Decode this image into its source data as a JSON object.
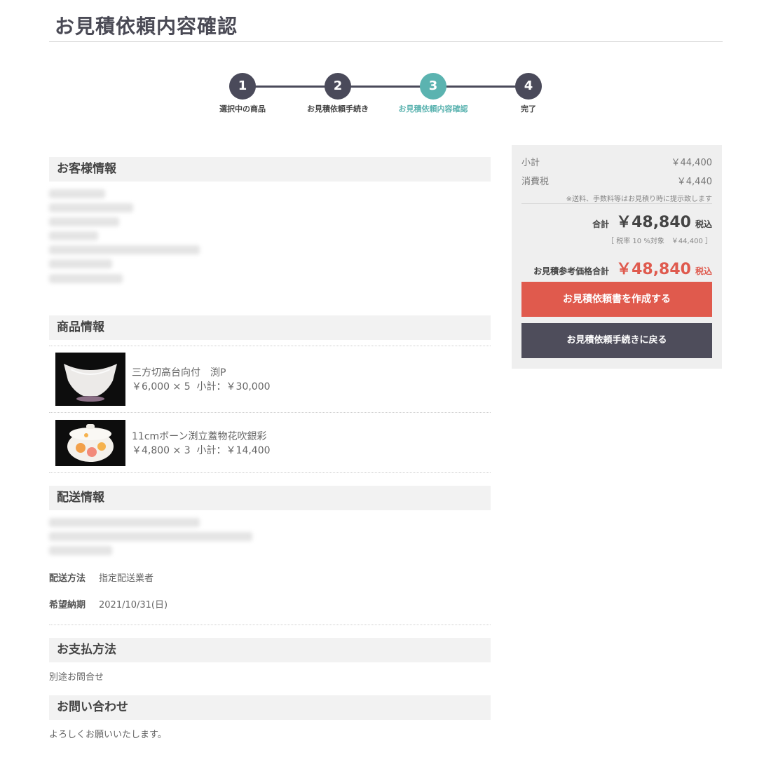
{
  "page": {
    "title": "お見積依頼内容確認"
  },
  "steps": [
    {
      "num": "1",
      "label": "選択中の商品"
    },
    {
      "num": "2",
      "label": "お見積依頼手続き"
    },
    {
      "num": "3",
      "label": "お見積依頼内容確認"
    },
    {
      "num": "4",
      "label": "完了"
    }
  ],
  "sections": {
    "customer": "お客様情報",
    "products": "商品情報",
    "shipping": "配送情報",
    "payment": "お支払方法",
    "inquiry": "お問い合わせ"
  },
  "products": [
    {
      "name": "三方切高台向付　渕P",
      "price": "￥6,000 × 5",
      "subtotal": "小計：￥30,000"
    },
    {
      "name": "11cmボーン渕立蓋物花吹銀彩",
      "price": "￥4,800 × 3",
      "subtotal": "小計：￥14,400"
    }
  ],
  "shipping": {
    "method_label": "配送方法",
    "method_value": "指定配送業者",
    "date_label": "希望納期",
    "date_value": "2021/10/31(日)"
  },
  "payment": {
    "value": "別途お問合せ"
  },
  "inquiry": {
    "value": "よろしくお願いいたします。"
  },
  "summary": {
    "subtotal_label": "小計",
    "subtotal_value": "￥44,400",
    "tax_label": "消費税",
    "tax_value": "￥4,440",
    "note": "※送料、手数料等はお見積り時に提示致します",
    "total_label": "合計",
    "total_value": "￥48,840",
    "total_tax": "税込",
    "rate_note": "［ 税率 10 %対象　￥44,400 ］",
    "ref_label": "お見積参考価格合計",
    "ref_value": "￥48,840",
    "ref_tax": "税込",
    "create_button": "お見積依頼書を作成する",
    "back_button": "お見積依頼手続きに戻る"
  }
}
